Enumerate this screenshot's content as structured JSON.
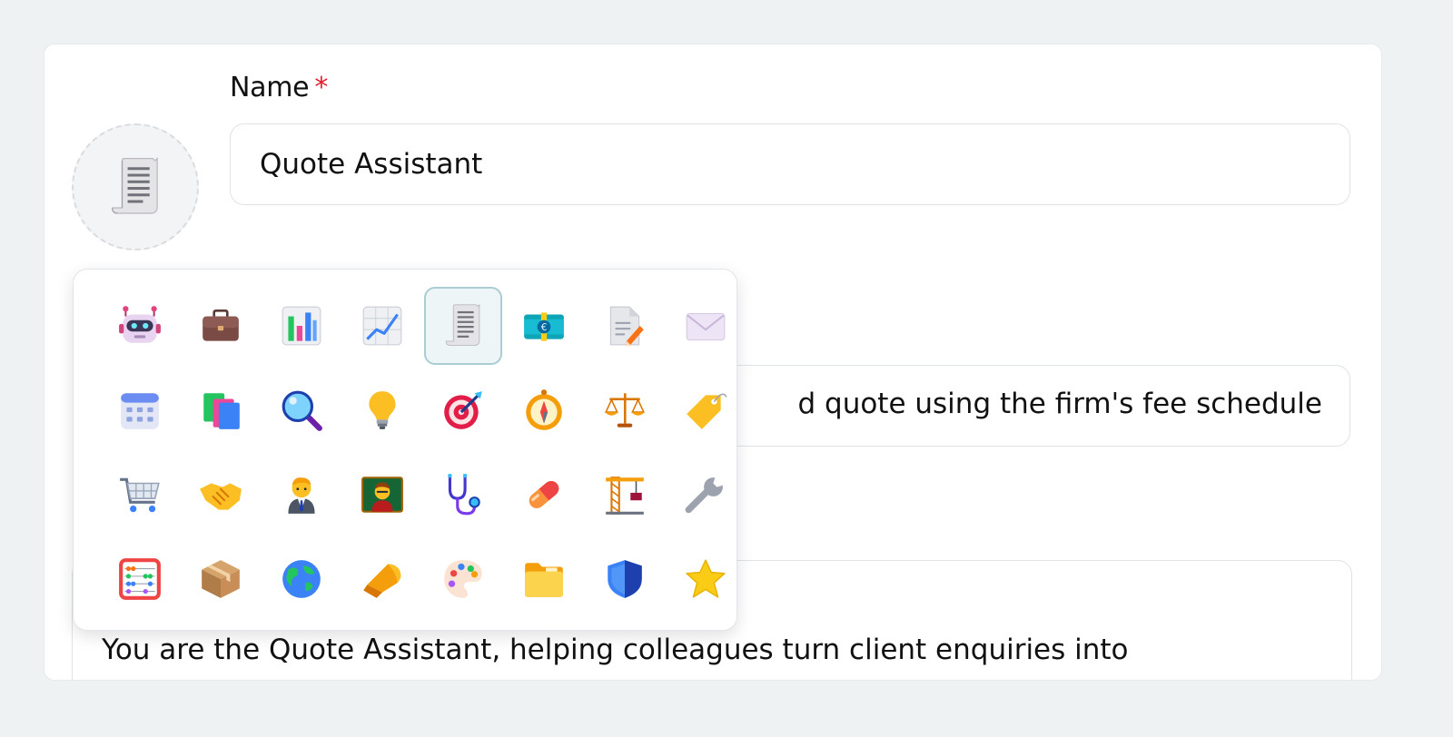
{
  "form": {
    "name_label": "Name",
    "required_marker": "*",
    "name_value": "Quote Assistant",
    "description_visible_text": "d quote using the firm's fee schedule",
    "instructions_first_line": "You are the Quote Assistant, helping colleagues turn client enquiries into"
  },
  "avatar": {
    "icon": "receipt-icon"
  },
  "icon_picker": {
    "selected_index": 4,
    "icons": [
      "robot-icon",
      "briefcase-icon",
      "bar-chart-icon",
      "trend-chart-icon",
      "receipt-icon",
      "banknote-icon",
      "document-pencil-icon",
      "envelope-icon",
      "calendar-icon",
      "books-icon",
      "magnifier-icon",
      "lightbulb-icon",
      "target-icon",
      "compass-icon",
      "scales-icon",
      "price-tag-icon",
      "shopping-cart-icon",
      "handshake-icon",
      "businessman-icon",
      "teacher-icon",
      "stethoscope-icon",
      "pill-icon",
      "crane-icon",
      "wrench-icon",
      "abacus-icon",
      "package-icon",
      "globe-icon",
      "megaphone-icon",
      "palette-icon",
      "folder-icon",
      "shield-icon",
      "star-icon"
    ]
  },
  "colors": {
    "required": "#e11d2e",
    "selected_border": "#a9cdd2",
    "selected_bg": "#eef5f6"
  }
}
